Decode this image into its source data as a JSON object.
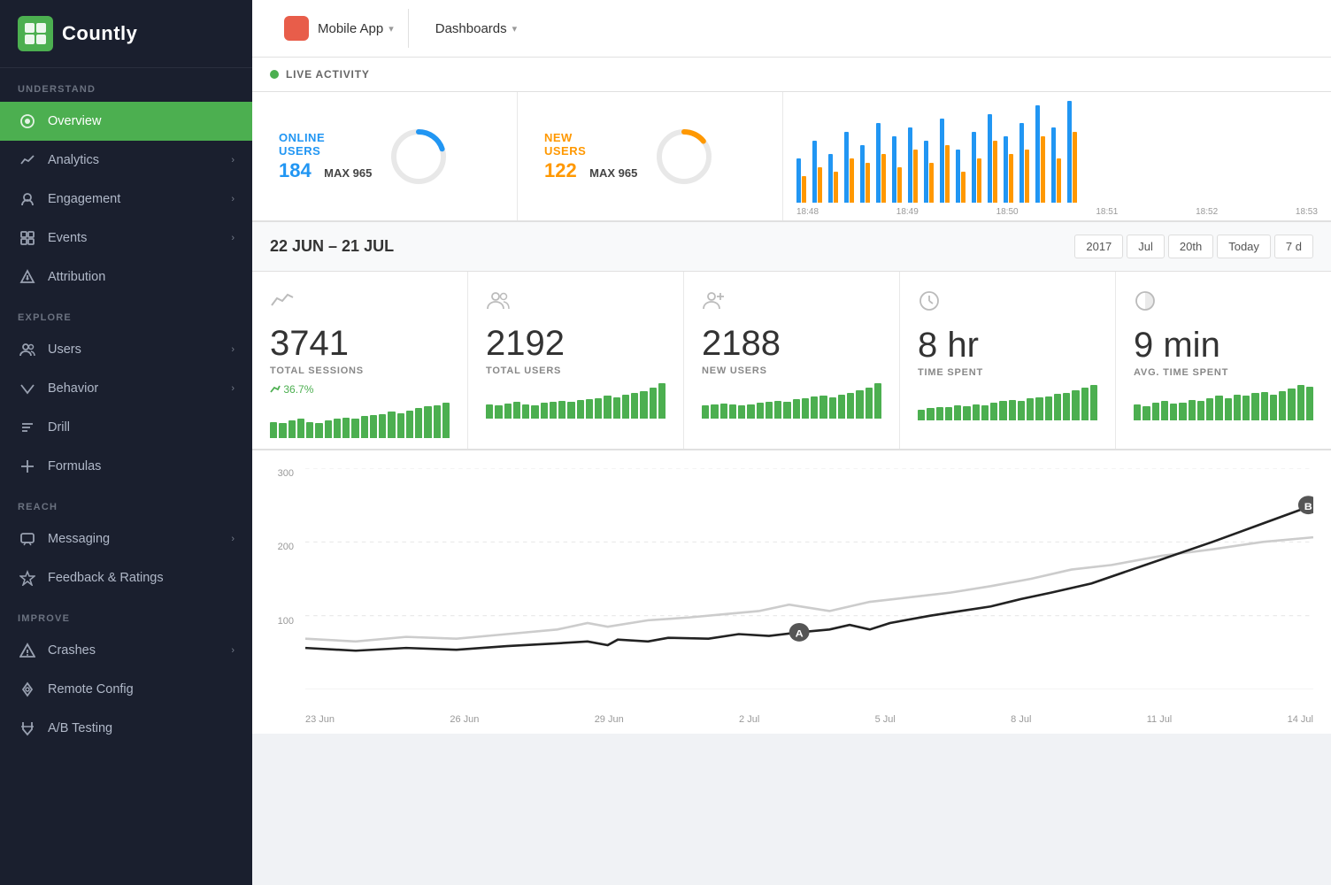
{
  "logo": {
    "icon_text": "13",
    "brand_name": "Countly"
  },
  "sidebar": {
    "sections": [
      {
        "label": "UNDERSTAND",
        "items": [
          {
            "id": "overview",
            "label": "Overview",
            "icon": "⊙",
            "active": true,
            "has_chevron": false
          },
          {
            "id": "analytics",
            "label": "Analytics",
            "icon": "〜",
            "active": false,
            "has_chevron": true
          },
          {
            "id": "engagement",
            "label": "Engagement",
            "icon": "☺",
            "active": false,
            "has_chevron": true
          },
          {
            "id": "events",
            "label": "Events",
            "icon": "◈",
            "active": false,
            "has_chevron": true
          },
          {
            "id": "attribution",
            "label": "Attribution",
            "icon": "⬧",
            "active": false,
            "has_chevron": false
          }
        ]
      },
      {
        "label": "EXPLORE",
        "items": [
          {
            "id": "users",
            "label": "Users",
            "icon": "👤",
            "active": false,
            "has_chevron": true
          },
          {
            "id": "behavior",
            "label": "Behavior",
            "icon": "▽",
            "active": false,
            "has_chevron": true
          },
          {
            "id": "drill",
            "label": "Drill",
            "icon": "⊟",
            "active": false,
            "has_chevron": false
          },
          {
            "id": "formulas",
            "label": "Formulas",
            "icon": "⊕",
            "active": false,
            "has_chevron": false
          }
        ]
      },
      {
        "label": "REACH",
        "items": [
          {
            "id": "messaging",
            "label": "Messaging",
            "icon": "💬",
            "active": false,
            "has_chevron": true
          },
          {
            "id": "feedback",
            "label": "Feedback & Ratings",
            "icon": "★",
            "active": false,
            "has_chevron": false
          }
        ]
      },
      {
        "label": "IMPROVE",
        "items": [
          {
            "id": "crashes",
            "label": "Crashes",
            "icon": "⚠",
            "active": false,
            "has_chevron": true
          },
          {
            "id": "remote-config",
            "label": "Remote Config",
            "icon": "⟳",
            "active": false,
            "has_chevron": false
          },
          {
            "id": "ab-testing",
            "label": "A/B Testing",
            "icon": "⚗",
            "active": false,
            "has_chevron": false
          }
        ]
      }
    ]
  },
  "topbar": {
    "app_name": "Mobile App",
    "dashboards_label": "Dashboards"
  },
  "live_activity": {
    "section_label": "LIVE ACTIVITY",
    "online_users": {
      "title": "ONLINE\nUSERS",
      "max_label": "MAX 965",
      "value": "184",
      "color": "#2196f3"
    },
    "new_users": {
      "title": "NEW\nUSERS",
      "max_label": "MAX 965",
      "value": "122",
      "color": "#ff9800"
    },
    "chart_times": [
      "18:48",
      "18:49",
      "18:50",
      "18:51",
      "18:52",
      "18:53"
    ]
  },
  "date_range": {
    "label": "22 JUN – 21 JUL",
    "filters": [
      "2017",
      "Jul",
      "20th",
      "Today",
      "7 d"
    ]
  },
  "stats": [
    {
      "id": "total-sessions",
      "icon": "∿",
      "number": "3741",
      "label": "TOTAL SESSIONS",
      "trend": "36.7%",
      "bars": [
        30,
        28,
        32,
        35,
        30,
        28,
        33,
        36,
        38,
        35,
        40,
        42,
        44,
        48,
        45,
        50,
        55,
        58,
        60,
        65
      ]
    },
    {
      "id": "total-users",
      "icon": "👥",
      "number": "2192",
      "label": "TOTAL USERS",
      "trend": null,
      "bars": [
        30,
        28,
        32,
        35,
        30,
        28,
        33,
        36,
        38,
        35,
        40,
        42,
        44,
        48,
        45,
        50,
        55,
        58,
        65,
        75
      ]
    },
    {
      "id": "new-users",
      "icon": "👤+",
      "number": "2188",
      "label": "NEW USERS",
      "trend": null,
      "bars": [
        28,
        30,
        32,
        30,
        28,
        30,
        33,
        35,
        38,
        35,
        42,
        44,
        46,
        48,
        45,
        50,
        55,
        60,
        65,
        75
      ]
    },
    {
      "id": "time-spent",
      "icon": "🕐",
      "number": "8 hr",
      "label": "TIME SPENT",
      "trend": null,
      "bars": [
        20,
        22,
        25,
        24,
        28,
        26,
        30,
        28,
        32,
        35,
        38,
        36,
        40,
        42,
        44,
        48,
        50,
        55,
        60,
        65
      ]
    },
    {
      "id": "avg-time-spent",
      "icon": "◑",
      "number": "9 min",
      "label": "AVG. TIME SPENT",
      "trend": null,
      "bars": [
        25,
        22,
        28,
        30,
        26,
        28,
        32,
        30,
        35,
        38,
        35,
        40,
        38,
        42,
        44,
        40,
        45,
        50,
        55,
        52
      ]
    }
  ],
  "line_chart": {
    "y_labels": [
      "300",
      "200",
      "100",
      ""
    ],
    "x_labels": [
      "23 Jun",
      "26 Jun",
      "29 Jun",
      "2 Jul",
      "5 Jul",
      "8 Jul",
      "11 Jul",
      "14 Jul"
    ]
  },
  "chart_marker_a": "A",
  "chart_marker_b": "B"
}
